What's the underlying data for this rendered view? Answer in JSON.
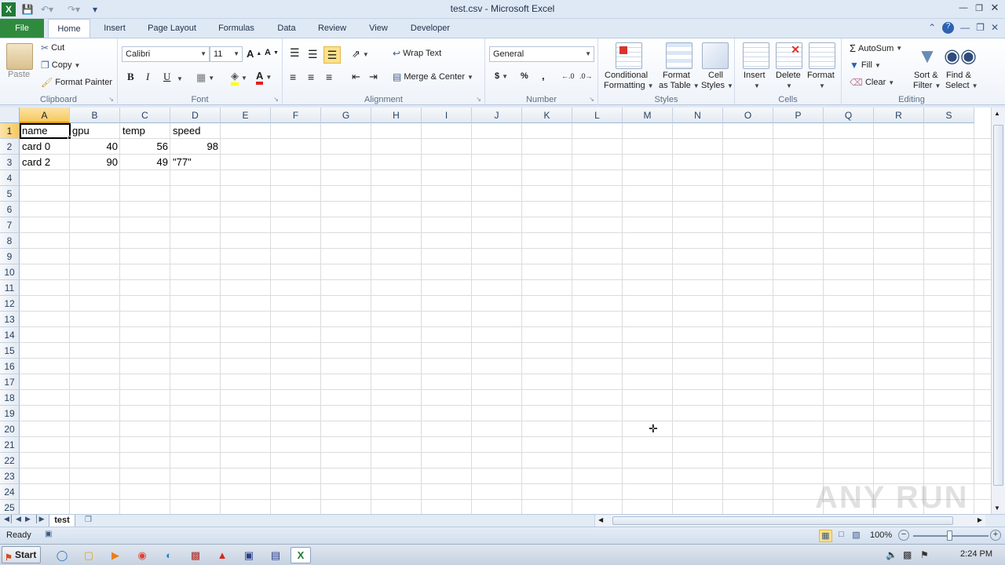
{
  "window": {
    "title": "test.csv - Microsoft Excel",
    "app_icon": "excel-icon"
  },
  "tabs": [
    "File",
    "Home",
    "Insert",
    "Page Layout",
    "Formulas",
    "Data",
    "Review",
    "View",
    "Developer"
  ],
  "ribbon": {
    "clipboard": {
      "label": "Clipboard",
      "paste": "Paste",
      "cut": "Cut",
      "copy": "Copy",
      "format_painter": "Format Painter"
    },
    "font": {
      "label": "Font",
      "family": "Calibri",
      "size": "11",
      "bold": "B",
      "italic": "I",
      "underline": "U"
    },
    "alignment": {
      "label": "Alignment",
      "wrap": "Wrap Text",
      "merge": "Merge & Center"
    },
    "number": {
      "label": "Number",
      "format": "General",
      "currency": "$",
      "percent": "%",
      "comma": ","
    },
    "styles": {
      "label": "Styles",
      "conditional_1": "Conditional",
      "conditional_2": "Formatting",
      "format_table_1": "Format",
      "format_table_2": "as Table",
      "cell_styles_1": "Cell",
      "cell_styles_2": "Styles"
    },
    "cells": {
      "label": "Cells",
      "insert": "Insert",
      "delete": "Delete",
      "format": "Format"
    },
    "editing": {
      "label": "Editing",
      "autosum": "AutoSum",
      "fill": "Fill",
      "clear": "Clear",
      "sort_1": "Sort &",
      "sort_2": "Filter",
      "find_1": "Find &",
      "find_2": "Select"
    }
  },
  "sheet": {
    "columns": [
      "A",
      "B",
      "C",
      "D",
      "E",
      "F",
      "G",
      "H",
      "I",
      "J",
      "K",
      "L",
      "M",
      "N",
      "O",
      "P",
      "Q",
      "R",
      "S"
    ],
    "rows": [
      "1",
      "2",
      "3",
      "4",
      "5",
      "6",
      "7",
      "8",
      "9",
      "10",
      "11",
      "12",
      "13",
      "14",
      "15",
      "16",
      "17",
      "18",
      "19",
      "20",
      "21",
      "22",
      "23",
      "24",
      "25"
    ],
    "active_cell": "A1",
    "cells": {
      "r1": [
        "name",
        "gpu",
        "temp",
        "speed"
      ],
      "r2": [
        "card 0",
        "40",
        "56",
        "98"
      ],
      "r3": [
        "card 2",
        "90",
        "49",
        "\"77\""
      ]
    },
    "tab_name": "test"
  },
  "status": {
    "ready": "Ready",
    "zoom": "100%"
  },
  "taskbar": {
    "start": "Start",
    "clock": "2:24 PM"
  },
  "watermark": "ANY RUN"
}
